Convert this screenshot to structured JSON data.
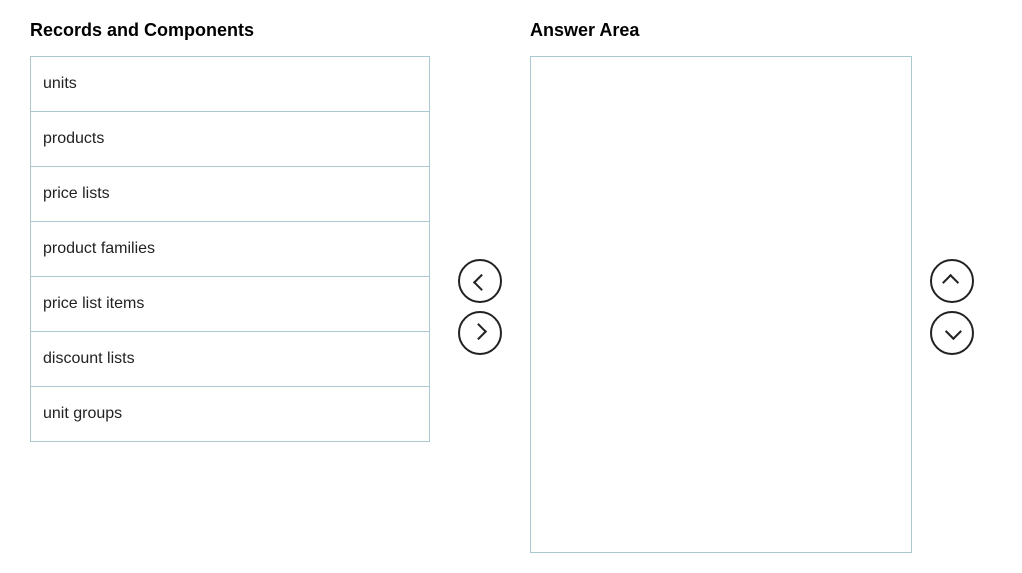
{
  "left_panel": {
    "header": "Records and Components",
    "items": [
      {
        "label": "units"
      },
      {
        "label": "products"
      },
      {
        "label": "price lists"
      },
      {
        "label": "product families"
      },
      {
        "label": "price list items"
      },
      {
        "label": "discount lists"
      },
      {
        "label": "unit groups"
      }
    ]
  },
  "right_panel": {
    "header": "Answer Area"
  },
  "controls": {
    "move_left_label": "move left",
    "move_right_label": "move right",
    "move_up_label": "move up",
    "move_down_label": "move down"
  }
}
